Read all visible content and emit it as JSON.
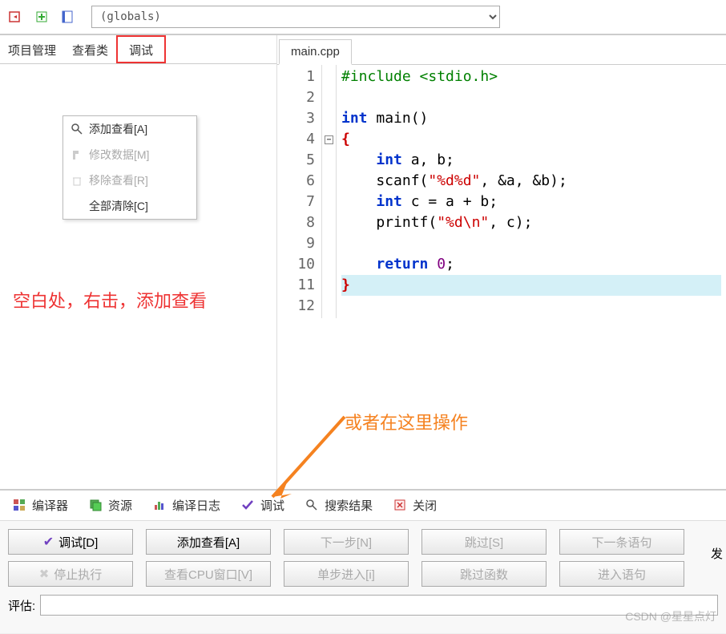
{
  "toolbar": {
    "globals_text": "(globals)"
  },
  "left_panel": {
    "tabs": [
      "项目管理",
      "查看类",
      "调试"
    ],
    "active_index": 2
  },
  "context_menu": {
    "items": [
      {
        "label": "添加查看[A]",
        "enabled": true,
        "icon": "search-icon"
      },
      {
        "label": "修改数据[M]",
        "enabled": false,
        "icon": "hammer-icon"
      },
      {
        "label": "移除查看[R]",
        "enabled": false,
        "icon": "trash-icon"
      },
      {
        "label": "全部清除[C]",
        "enabled": true,
        "icon": ""
      }
    ]
  },
  "annotations": {
    "red_text": "空白处，右击，添加查看",
    "orange_text": "或者在这里操作"
  },
  "editor": {
    "filename": "main.cpp",
    "lines": [
      {
        "n": "1",
        "type": "pre",
        "text": "#include <stdio.h>"
      },
      {
        "n": "2",
        "type": "blank",
        "text": ""
      },
      {
        "n": "3",
        "type": "code",
        "tokens": [
          {
            "c": "kw",
            "t": "int"
          },
          {
            "c": "pn",
            "t": " main()"
          }
        ]
      },
      {
        "n": "4",
        "type": "brace-open",
        "text": "{",
        "fold": true
      },
      {
        "n": "5",
        "type": "code",
        "tokens": [
          {
            "c": "pn",
            "t": "    "
          },
          {
            "c": "kw",
            "t": "int"
          },
          {
            "c": "pn",
            "t": " a, b;"
          }
        ]
      },
      {
        "n": "6",
        "type": "code",
        "tokens": [
          {
            "c": "pn",
            "t": "    scanf("
          },
          {
            "c": "str",
            "t": "\"%d%d\""
          },
          {
            "c": "pn",
            "t": ", &a, &b);"
          }
        ]
      },
      {
        "n": "7",
        "type": "code",
        "tokens": [
          {
            "c": "pn",
            "t": "    "
          },
          {
            "c": "kw",
            "t": "int"
          },
          {
            "c": "pn",
            "t": " c = a + b;"
          }
        ]
      },
      {
        "n": "8",
        "type": "code",
        "tokens": [
          {
            "c": "pn",
            "t": "    printf("
          },
          {
            "c": "str",
            "t": "\"%d\\n\""
          },
          {
            "c": "pn",
            "t": ", c);"
          }
        ]
      },
      {
        "n": "9",
        "type": "blank",
        "text": ""
      },
      {
        "n": "10",
        "type": "code",
        "tokens": [
          {
            "c": "pn",
            "t": "    "
          },
          {
            "c": "kw",
            "t": "return"
          },
          {
            "c": "pn",
            "t": " "
          },
          {
            "c": "num",
            "t": "0"
          },
          {
            "c": "pn",
            "t": ";"
          }
        ]
      },
      {
        "n": "11",
        "type": "brace-close",
        "text": "}",
        "hl": true
      },
      {
        "n": "12",
        "type": "blank",
        "text": ""
      }
    ]
  },
  "bottom_tabs": [
    {
      "label": "编译器",
      "icon": "grid-icon"
    },
    {
      "label": "资源",
      "icon": "stack-icon"
    },
    {
      "label": "编译日志",
      "icon": "chart-icon"
    },
    {
      "label": "调试",
      "icon": "check-icon"
    },
    {
      "label": "搜索结果",
      "icon": "search-icon"
    },
    {
      "label": "关闭",
      "icon": "close-icon"
    }
  ],
  "debug_buttons": {
    "row1": [
      {
        "label": "调试[D]",
        "enabled": true,
        "check": true
      },
      {
        "label": "添加查看[A]",
        "enabled": true
      },
      {
        "label": "下一步[N]",
        "enabled": false
      },
      {
        "label": "跳过[S]",
        "enabled": false
      },
      {
        "label": "下一条语句",
        "enabled": false
      }
    ],
    "row2": [
      {
        "label": "停止执行",
        "enabled": false,
        "x": true
      },
      {
        "label": "查看CPU窗口[V]",
        "enabled": false
      },
      {
        "label": "单步进入[i]",
        "enabled": false
      },
      {
        "label": "跳过函数",
        "enabled": false
      },
      {
        "label": "进入语句",
        "enabled": false
      }
    ]
  },
  "side_label": "发",
  "eval": {
    "label": "评估:",
    "value": ""
  },
  "watermark": "CSDN @星星点灯"
}
